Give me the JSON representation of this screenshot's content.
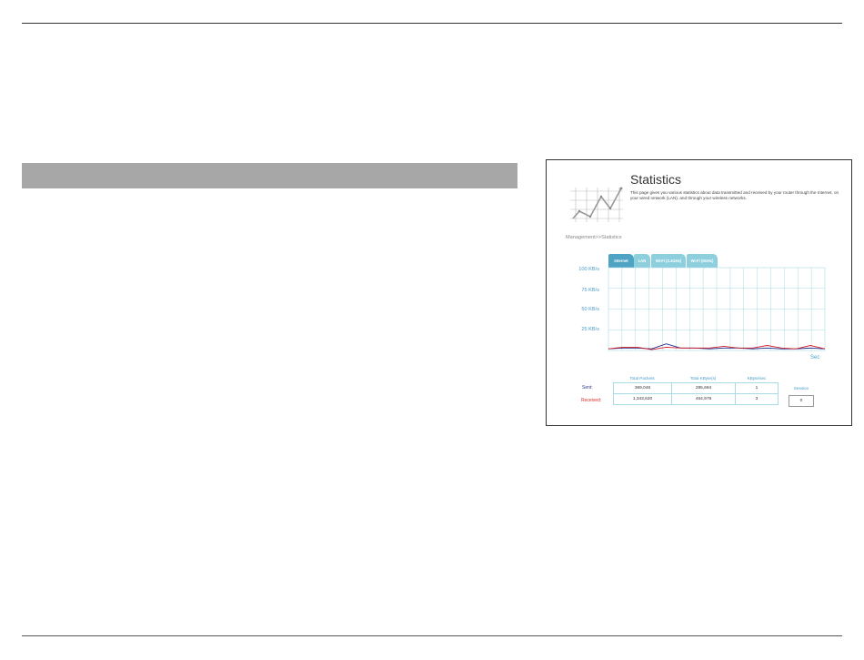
{
  "page": {
    "title": "Statistics",
    "description": "This page gives you various statistics about data transmitted and received by your router through the Internet, on your wired network (LAN), and through your wireless networks.",
    "breadcrumb": "Management>>Statistics"
  },
  "tabs": [
    {
      "label": "Internet",
      "active": true
    },
    {
      "label": "LAN",
      "active": false
    },
    {
      "label": "Wi-Fi (2.4GHz)",
      "active": false
    },
    {
      "label": "Wi-Fi (5GHz)",
      "active": false
    }
  ],
  "chart_data": {
    "type": "line",
    "ylim": [
      0,
      100
    ],
    "y_ticks": [
      "100 KB/s",
      "75 KB/s",
      "50 KB/s",
      "25 KB/s"
    ],
    "xlabel": "Sec",
    "grid": true,
    "series": [
      {
        "name": "Sent",
        "color": "#1d2c8c",
        "values": [
          2,
          3,
          3,
          2,
          8,
          3,
          3,
          2,
          3,
          3,
          2,
          3,
          2,
          2,
          3,
          2
        ]
      },
      {
        "name": "Received",
        "color": "#d21f2a",
        "values": [
          2,
          4,
          4,
          1,
          4,
          3,
          3,
          3,
          5,
          3,
          3,
          6,
          3,
          2,
          6,
          2
        ]
      }
    ]
  },
  "table": {
    "headers": [
      "Total Packets",
      "Total KByte(s)",
      "KByte/sec",
      "Session"
    ],
    "rows": [
      {
        "label": "Sent:",
        "color": "#2d3a8c",
        "values": [
          "369,046",
          "285,694",
          "1"
        ]
      },
      {
        "label": "Received:",
        "color": "#e02a2a",
        "values": [
          "1,343,620",
          "464,978",
          "3"
        ]
      }
    ],
    "session": "0"
  },
  "colors": {
    "accent": "#4a9cc7",
    "tab_active": "#4ea4c2",
    "tab_inactive": "#8ecfde",
    "grid": "#a8dbe5"
  }
}
